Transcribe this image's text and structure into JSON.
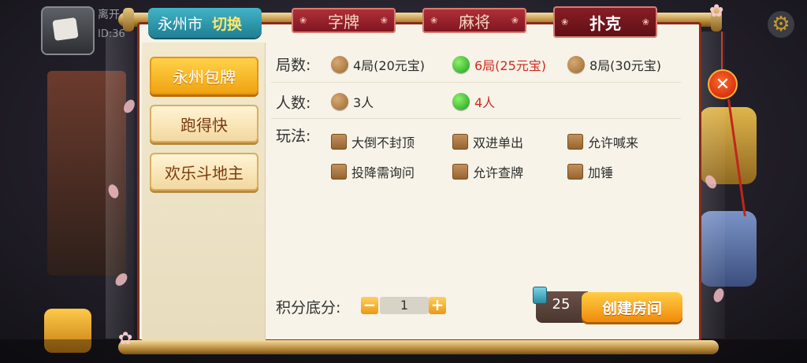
{
  "background": {
    "player_name": "离开",
    "player_id": "ID:36",
    "icons": [
      "settings-gear-icon",
      "shop-cart-icon"
    ]
  },
  "header": {
    "region": "永州市",
    "region_switch": "切换",
    "tabs": [
      {
        "label": "字牌",
        "active": false
      },
      {
        "label": "麻将",
        "active": false
      },
      {
        "label": "扑克",
        "active": true
      }
    ]
  },
  "sidebar": {
    "games": [
      {
        "label": "永州包牌",
        "active": true
      },
      {
        "label": "跑得快",
        "active": false
      },
      {
        "label": "欢乐斗地主",
        "active": false
      }
    ]
  },
  "options": {
    "rounds": {
      "label": "局数:",
      "choices": [
        {
          "label": "4局(20元宝)",
          "selected": false
        },
        {
          "label": "6局(25元宝)",
          "selected": true
        },
        {
          "label": "8局(30元宝)",
          "selected": false
        }
      ]
    },
    "players": {
      "label": "人数:",
      "choices": [
        {
          "label": "3人",
          "selected": false
        },
        {
          "label": "4人",
          "selected": true
        }
      ]
    },
    "rules": {
      "label": "玩法:",
      "choices": [
        {
          "label": "大倒不封顶",
          "checked": false
        },
        {
          "label": "双进单出",
          "checked": false
        },
        {
          "label": "允许喊来",
          "checked": false
        },
        {
          "label": "投降需询问",
          "checked": false
        },
        {
          "label": "允许查牌",
          "checked": false
        },
        {
          "label": "加锤",
          "checked": false
        }
      ]
    }
  },
  "footer": {
    "score_label": "积分底分:",
    "score_value": "1",
    "minus": "−",
    "plus": "+",
    "gem_count": "25",
    "create_button": "创建房间"
  },
  "close_label": "✕",
  "colors": {
    "panel": "#f7f3e8",
    "border": "#8a2a1a",
    "tab_red": "#b4303a",
    "accent_orange": "#f0a311",
    "selected_green": "#1e9c1f",
    "selected_text": "#d02a1f",
    "region_teal": "#1e7f93"
  }
}
